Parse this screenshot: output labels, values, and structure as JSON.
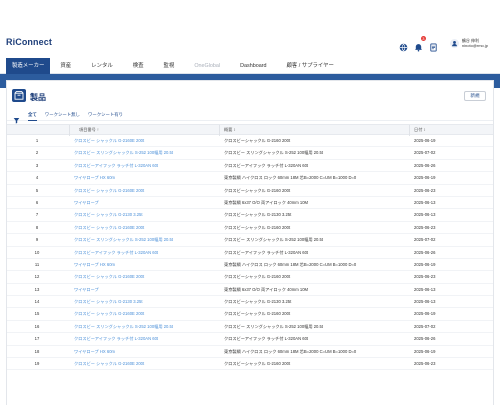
{
  "app": {
    "logo_r": "R",
    "logo_i": "i",
    "logo_rest": "Connect"
  },
  "header": {
    "notification_count": "3",
    "user_name": "鶴谷 伸利",
    "user_email": "ninoto@rmo.jp"
  },
  "nav": {
    "items": [
      {
        "label": "製造メーカー",
        "state": "active"
      },
      {
        "label": "資産",
        "state": "normal"
      },
      {
        "label": "レンタル",
        "state": "normal"
      },
      {
        "label": "検査",
        "state": "normal"
      },
      {
        "label": "監視",
        "state": "normal"
      },
      {
        "label": "OneGlobal",
        "state": "disabled"
      },
      {
        "label": "Dashboard",
        "state": "normal"
      },
      {
        "label": "顧客 / サプライヤー",
        "state": "normal"
      }
    ]
  },
  "page": {
    "title": "製品",
    "new_button": "新規"
  },
  "filters": {
    "tabs": [
      "全て",
      "ワークシート無し",
      "ワークシート有り"
    ]
  },
  "table": {
    "columns": [
      "",
      "項目番号 ↑",
      "概要 ↕",
      "日付 ↕"
    ],
    "rows": [
      {
        "no": "1",
        "item": "クロスビー シャックル G-2160E 200t",
        "desc": "クロスビーシャックル G-2160 200t",
        "date": "2025-06-19"
      },
      {
        "no": "2",
        "item": "クロスビー スリングシャックル S-252 100幅用 20.5t",
        "desc": "クロスビー スリングシャックル S-252 100幅用 20.5t",
        "date": "2025-07-02"
      },
      {
        "no": "3",
        "item": "クロスビーアイフック ラッチ付 L-320AN 60t",
        "desc": "クロスビーアイフック ラッチ付 L-320AN 60t",
        "date": "2025-06-26"
      },
      {
        "no": "4",
        "item": "ワイヤロープ HX 60m",
        "desc": "東京製綱 ハイクロス ロック 60mm 18M 芯B=2000 C=UM B=1000 D=0",
        "date": "2025-06-19"
      },
      {
        "no": "5",
        "item": "クロスビー シャックル G-2160E 200t",
        "desc": "クロスビーシャックル G-2160 200t",
        "date": "2025-06-23"
      },
      {
        "no": "6",
        "item": "ワイヤロープ",
        "desc": "東京製綱 6x37 O/O 両アイロック 40mm 10M",
        "date": "2025-06-13"
      },
      {
        "no": "7",
        "item": "クロスビー シャックル G-2130 3.25t",
        "desc": "クロスビーシャックル G-2130 3.25t",
        "date": "2025-06-13"
      },
      {
        "no": "8",
        "item": "クロスビー シャックル G-2160E 200t",
        "desc": "クロスビーシャックル G-2160 200t",
        "date": "2025-06-23"
      },
      {
        "no": "9",
        "item": "クロスビー スリングシャックル S-252 100幅用 20.5t",
        "desc": "クロスビー スリングシャックル S-252 100幅用 20.5t",
        "date": "2025-07-02"
      },
      {
        "no": "10",
        "item": "クロスビーアイフック ラッチ付 L-320AN 60t",
        "desc": "クロスビーアイフック ラッチ付 L-320AN 60t",
        "date": "2025-06-26"
      },
      {
        "no": "11",
        "item": "ワイヤロープ HX 60m",
        "desc": "東京製綱 ハイクロス ロック 60mm 18M 芯B=2000 C=UM B=1000 D=0",
        "date": "2025-06-19"
      },
      {
        "no": "12",
        "item": "クロスビー シャックル G-2160E 200t",
        "desc": "クロスビーシャックル G-2160 200t",
        "date": "2025-06-23"
      },
      {
        "no": "13",
        "item": "ワイヤロープ",
        "desc": "東京製綱 6x37 O/O 両アイロック 40mm 10M",
        "date": "2025-06-13"
      },
      {
        "no": "14",
        "item": "クロスビー シャックル G-2130 3.25t",
        "desc": "クロスビーシャックル G-2130 3.25t",
        "date": "2025-06-13"
      },
      {
        "no": "15",
        "item": "クロスビー シャックル G-2160E 200t",
        "desc": "クロスビーシャックル G-2160 200t",
        "date": "2025-06-19"
      },
      {
        "no": "16",
        "item": "クロスビー スリングシャックル S-252 100幅用 20.5t",
        "desc": "クロスビー スリングシャックル S-252 100幅用 20.5t",
        "date": "2025-07-02"
      },
      {
        "no": "17",
        "item": "クロスビーアイフック ラッチ付 L-320AN 60t",
        "desc": "クロスビーアイフック ラッチ付 L-320AN 60t",
        "date": "2025-06-26"
      },
      {
        "no": "18",
        "item": "ワイヤロープ HX 60m",
        "desc": "東京製綱 ハイクロス ロック 60mm 18M 芯B=2000 C=UM B=1000 D=0",
        "date": "2025-06-19"
      },
      {
        "no": "19",
        "item": "クロスビー シャックル G-2160E 200t",
        "desc": "クロスビーシャックル G-2160 200t",
        "date": "2025-06-23"
      }
    ]
  },
  "colors": {
    "brand": "#1f4a8c",
    "link": "#4a8fd8",
    "band": "#2c5c9e"
  }
}
